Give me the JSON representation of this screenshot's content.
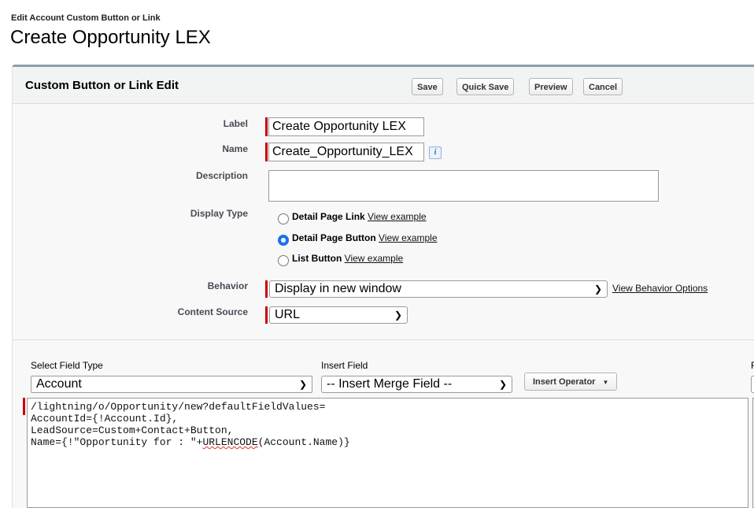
{
  "header": {
    "subtitle": "Edit Account Custom Button or Link",
    "title": "Create Opportunity LEX"
  },
  "panel": {
    "title": "Custom Button or Link Edit",
    "buttons": {
      "save": "Save",
      "quick_save": "Quick Save",
      "preview": "Preview",
      "cancel": "Cancel"
    }
  },
  "form": {
    "label": {
      "label": "Label",
      "value": "Create Opportunity LEX"
    },
    "name": {
      "label": "Name",
      "value": "Create_Opportunity_LEX",
      "info_icon": "info-icon"
    },
    "description": {
      "label": "Description",
      "value": ""
    },
    "display_type": {
      "label": "Display Type",
      "options": [
        {
          "text": "Detail Page Link",
          "link": "View example",
          "selected": false
        },
        {
          "text": "Detail Page Button",
          "link": "View example",
          "selected": true
        },
        {
          "text": "List Button",
          "link": "View example",
          "selected": false
        }
      ]
    },
    "behavior": {
      "label": "Behavior",
      "value": "Display in new window",
      "link": "View Behavior Options"
    },
    "content_source": {
      "label": "Content Source",
      "value": "URL"
    }
  },
  "formula": {
    "select_field_type": {
      "label": "Select Field Type",
      "value": "Account"
    },
    "insert_field": {
      "label": "Insert Field",
      "value": "-- Insert Merge Field --"
    },
    "insert_operator": "Insert Operator",
    "clipped_label": "F",
    "code_lines": [
      "/lightning/o/Opportunity/new?defaultFieldValues=",
      "AccountId={!Account.Id},",
      "LeadSource=Custom+Contact+Button,"
    ],
    "code_last_line": {
      "prefix": "Name={!\"Opportunity for : \"+",
      "flagged": "URLENCODE",
      "suffix": "(Account.Name)}"
    }
  }
}
